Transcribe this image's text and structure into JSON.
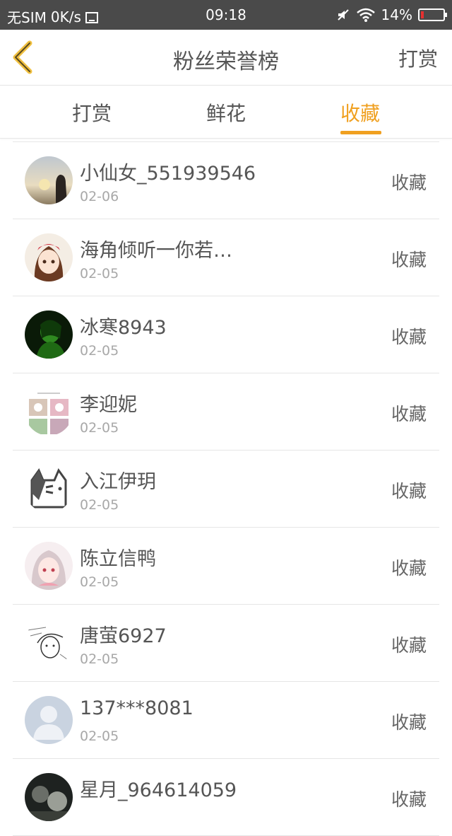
{
  "status": {
    "carrier": "无SIM",
    "speed": "0K/s",
    "time": "09:18",
    "battery_percent": "14%",
    "battery_level": 0.14
  },
  "header": {
    "title": "粉丝荣誉榜",
    "action": "打赏",
    "back_icon": "chevron-left-icon",
    "accent": "#f0a020"
  },
  "tabs": [
    {
      "label": "打赏",
      "active": false
    },
    {
      "label": "鲜花",
      "active": false
    },
    {
      "label": "收藏",
      "active": true
    }
  ],
  "items": [
    {
      "name": "小仙女_551939546",
      "date": "02-06",
      "action": "收藏",
      "avatar": "sunset-silhouette"
    },
    {
      "name": "海角倾听一你若…",
      "date": "02-05",
      "action": "收藏",
      "avatar": "anime-girl"
    },
    {
      "name": "冰寒8943",
      "date": "02-05",
      "action": "收藏",
      "avatar": "green-portrait"
    },
    {
      "name": "李迎妮",
      "date": "02-05",
      "action": "收藏",
      "avatar": "photo-collage"
    },
    {
      "name": "入江伊玥",
      "date": "02-05",
      "action": "收藏",
      "avatar": "cartoon-cat"
    },
    {
      "name": "陈立信鸭",
      "date": "02-05",
      "action": "收藏",
      "avatar": "anime-girl-pink"
    },
    {
      "name": "唐萤6927",
      "date": "02-05",
      "action": "收藏",
      "avatar": "sketch-portrait"
    },
    {
      "name": "137***8081",
      "date": "02-05",
      "action": "收藏",
      "avatar": "default-user"
    },
    {
      "name": "星月_964614059",
      "date": "",
      "action": "收藏",
      "avatar": "dark-photo"
    }
  ]
}
